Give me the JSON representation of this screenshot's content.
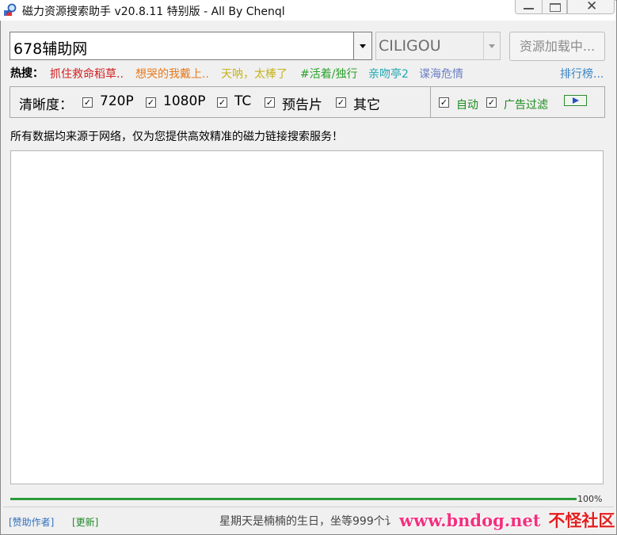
{
  "window": {
    "title": "磁力资源搜索助手 v20.8.11 特别版 - All By Chenql",
    "close_glyph": "✕"
  },
  "search": {
    "query": "678辅助网",
    "source": "CILIGOU",
    "load_button": "资源加载中..."
  },
  "hot": {
    "label": "热搜：",
    "items": [
      {
        "text": "抓住救命稻草..",
        "color": "#d22020"
      },
      {
        "text": "想哭的我戴上..",
        "color": "#e67a1e"
      },
      {
        "text": "天呐，太棒了",
        "color": "#c6b21a"
      },
      {
        "text": "#活着/独行",
        "color": "#2aa02a"
      },
      {
        "text": "亲吻亭2",
        "color": "#21a7b0"
      },
      {
        "text": "谍海危情",
        "color": "#6b7fc4"
      }
    ],
    "rank_link": "排行榜..."
  },
  "quality": {
    "label": "清晰度：",
    "options": [
      {
        "label": "720P",
        "checked": true
      },
      {
        "label": "1080P",
        "checked": true
      },
      {
        "label": "TC",
        "checked": true
      },
      {
        "label": "预告片",
        "checked": true
      },
      {
        "label": "其它",
        "checked": true
      }
    ],
    "auto": {
      "label": "自动",
      "checked": true
    },
    "ad_filter": {
      "label": "广告过滤",
      "checked": true
    },
    "check_glyph": "✓"
  },
  "notice": "所有数据均来源于网络，仅为您提供高效精准的磁力链接搜索服务！",
  "progress": {
    "value": 100,
    "label": "100%"
  },
  "footer": {
    "sponsor": "[赞助作者]",
    "update": "[更新]",
    "status": "星期天是楠楠的生日，坐等999个讠",
    "watermark_url": "www.bndog.net",
    "watermark_cn": "不怪社区"
  },
  "colors": {
    "accent_green": "#2c9b3a",
    "link_blue": "#3a84c4"
  }
}
